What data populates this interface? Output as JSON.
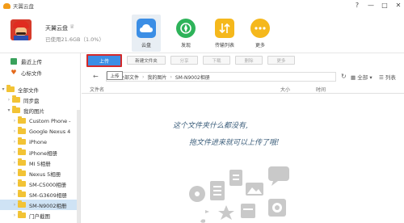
{
  "app": {
    "title": "天翼云盘",
    "window_controls": [
      "?",
      "—",
      "□",
      "✕"
    ]
  },
  "user": {
    "name": "天翼云盘",
    "storage": "已使用21.6GB（1.0%）"
  },
  "nav": [
    {
      "label": "云盘",
      "icon": "cloud-icon",
      "color": "#3b8ee5",
      "active": true
    },
    {
      "label": "发现",
      "icon": "compass-icon",
      "color": "#2eb35a",
      "active": false
    },
    {
      "label": "传输列表",
      "icon": "transfer-icon",
      "color": "#f5b81c",
      "active": false
    },
    {
      "label": "更多",
      "icon": "more-icon",
      "color": "#f5b81c",
      "active": false
    }
  ],
  "sidebar": {
    "recent": "最近上传",
    "favorites": "心标文件",
    "all_files": "全部文件",
    "sync": "同步盘",
    "my_photos": "我的图片",
    "folders": [
      "Custom Phone -",
      "Google Nexus 4",
      "iPhone",
      "iPhone相册",
      "MI 5相册",
      "Nexus 5相册",
      "SM-C5000相册",
      "SM-G3609相册",
      "SM-N9002相册",
      "门户截图"
    ],
    "selected_folder": "SM-N9002相册"
  },
  "toolbar": {
    "upload": "上传",
    "new_folder": "新建文件夹",
    "share": "分享",
    "download": "下载",
    "delete": "删除",
    "more": "更多",
    "tooltip": "上传"
  },
  "path": {
    "segments": [
      "全部文件",
      "我的图片",
      "SM-N9002相册"
    ],
    "filter": "全部",
    "view": "列表"
  },
  "columns": {
    "name": "文件名",
    "size": "大小",
    "time": "时间"
  },
  "empty": {
    "line1": "这个文件夹什么都没有,",
    "line2": "拖文件进来就可以上传了哦!"
  }
}
